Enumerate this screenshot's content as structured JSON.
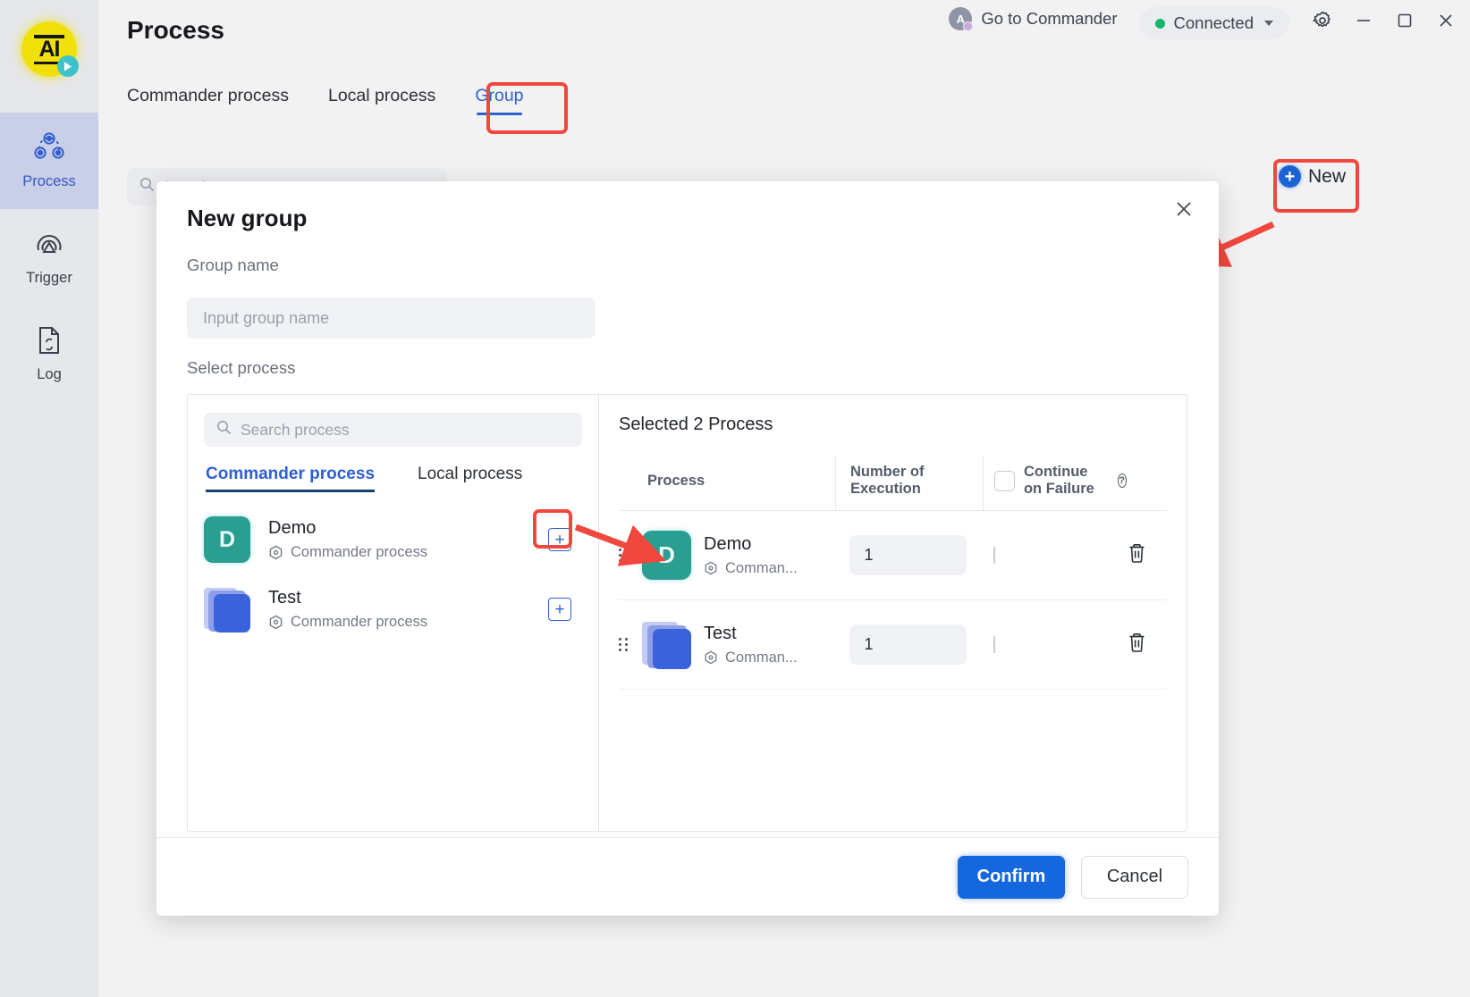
{
  "app": {
    "logo_text": "AI",
    "page_title": "Process"
  },
  "header": {
    "commander_link": "Go to Commander",
    "commander_badge": "A",
    "connection_status": "Connected",
    "status_color": "#15b86b",
    "gear_icon": "gear-icon",
    "minimize_icon": "minimize-icon",
    "maximize_icon": "maximize-icon",
    "close_icon": "close-icon"
  },
  "sidebar": {
    "items": [
      {
        "label": "Process",
        "icon": "process-icon",
        "active": true
      },
      {
        "label": "Trigger",
        "icon": "trigger-icon",
        "active": false
      },
      {
        "label": "Log",
        "icon": "log-icon",
        "active": false
      }
    ]
  },
  "tabs": [
    {
      "label": "Commander process",
      "active": false
    },
    {
      "label": "Local process",
      "active": false
    },
    {
      "label": "Group",
      "active": true
    }
  ],
  "toolbar": {
    "search_placeholder": "Search",
    "new_label": "New",
    "new_icon": "plus-circle-icon"
  },
  "modal": {
    "title": "New group",
    "close_icon": "close-icon",
    "group_name_label": "Group name",
    "group_name_value": "",
    "group_name_placeholder": "Input group name",
    "select_process_label": "Select process",
    "left_panel": {
      "search_value": "",
      "search_placeholder": "Search process",
      "search_icon": "search-icon",
      "tabs": [
        {
          "label": "Commander process",
          "active": true
        },
        {
          "label": "Local process",
          "active": false
        }
      ],
      "items": [
        {
          "name": "Demo",
          "type": "Commander process",
          "initial": "D",
          "icon": "demo-avatar-icon",
          "icon_color": "#2b9e92",
          "add_icon": "plus-square-icon"
        },
        {
          "name": "Test",
          "type": "Commander process",
          "initial": "",
          "icon": "test-stack-icon",
          "icon_color": "#3a63db",
          "add_icon": "plus-square-icon"
        }
      ]
    },
    "right_panel": {
      "selected_title": "Selected 2 Process",
      "columns": {
        "process": "Process",
        "number_of_execution": "Number of Execution",
        "continue_on_failure": "Continue on Failure",
        "continue_help_icon": "help-icon"
      },
      "header_checkbox_checked": false,
      "rows": [
        {
          "name": "Demo",
          "type": "Comman...",
          "initial": "D",
          "icon": "demo-avatar-icon",
          "executions": "1",
          "continue_on_failure": false,
          "delete_icon": "trash-icon",
          "drag_icon": "drag-handle-icon"
        },
        {
          "name": "Test",
          "type": "Comman...",
          "initial": "",
          "icon": "test-stack-icon",
          "executions": "1",
          "continue_on_failure": false,
          "delete_icon": "trash-icon",
          "drag_icon": "drag-handle-icon"
        }
      ]
    },
    "confirm_label": "Confirm",
    "cancel_label": "Cancel"
  },
  "annotations": {
    "highlight_color": "#f0483e",
    "boxes": [
      "group-tab",
      "new-button",
      "add-demo-button"
    ],
    "arrows": [
      "new-button-arrow",
      "add-to-table-arrow"
    ]
  }
}
